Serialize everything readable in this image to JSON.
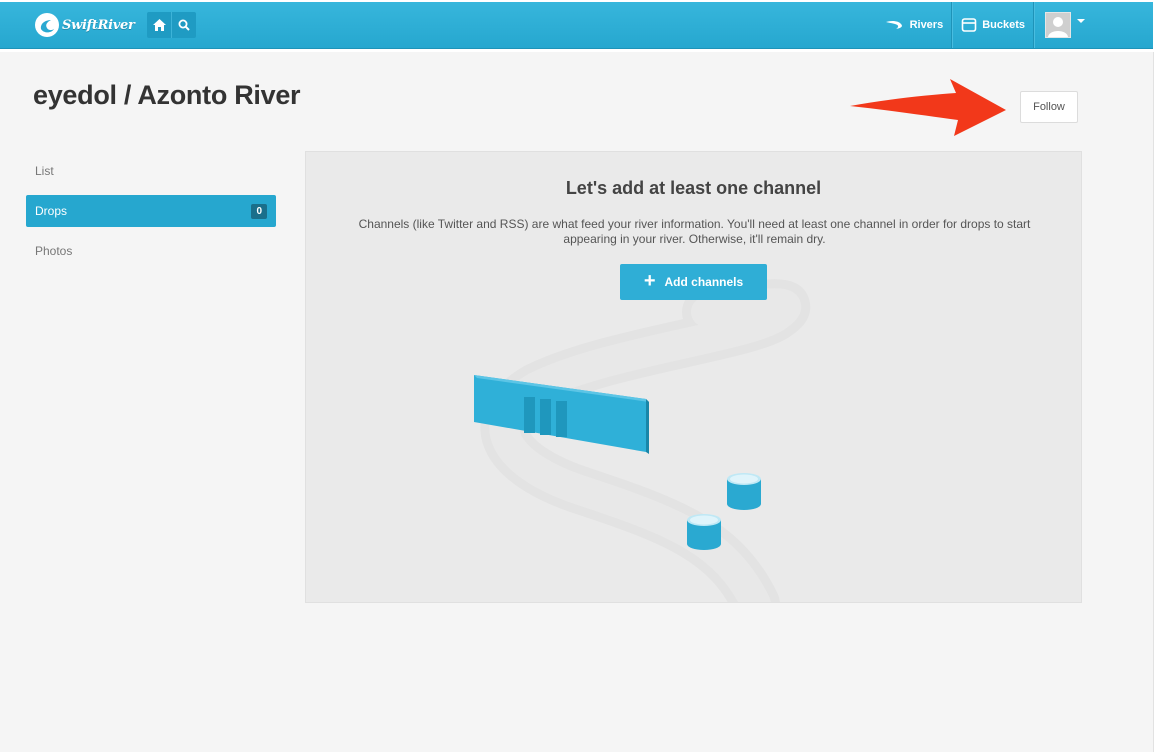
{
  "header": {
    "logo_text": "SwiftRiver",
    "nav_icons": [
      "home-icon",
      "search-icon"
    ],
    "right_nav": [
      {
        "label": "Rivers",
        "icon": "rivers-icon"
      },
      {
        "label": "Buckets",
        "icon": "bucket-icon"
      }
    ],
    "colors": {
      "bar": "#2aa9d1",
      "accent": "#26a7cf"
    }
  },
  "page": {
    "title": "eyedol / Azonto River",
    "follow_label": "Follow"
  },
  "sidebar": {
    "items": [
      {
        "label": "List",
        "active": false
      },
      {
        "label": "Drops",
        "active": true,
        "count": "0"
      },
      {
        "label": "Photos",
        "active": false
      }
    ]
  },
  "empty_state": {
    "title": "Let's add at least one channel",
    "description": "Channels (like Twitter and RSS) are what feed your river information. You'll need at least one channel in order for drops to start appearing in your river. Otherwise, it'll remain dry.",
    "button_label": "Add channels",
    "button_icon": "plus-icon"
  },
  "annotation": {
    "arrow_color": "#f2381a"
  }
}
